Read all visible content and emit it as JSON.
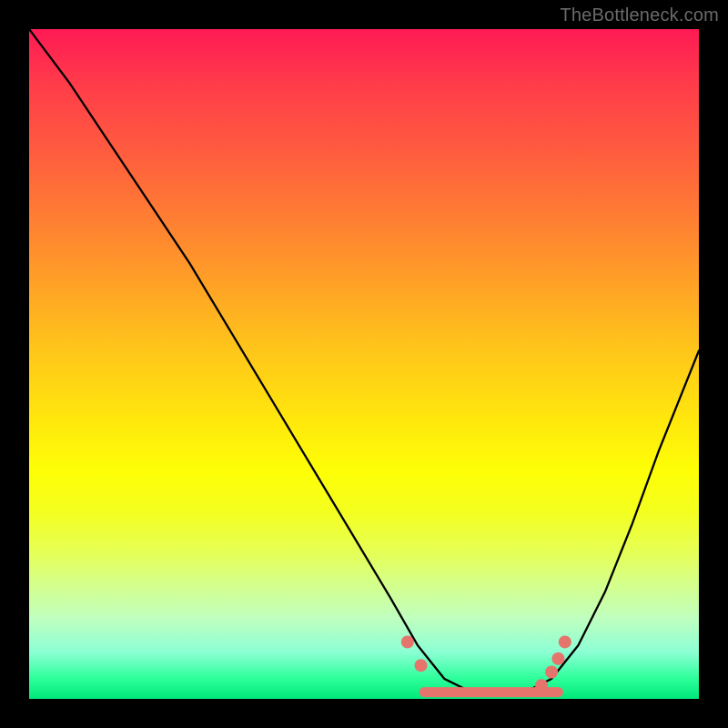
{
  "watermark": "TheBottleneck.com",
  "chart_data": {
    "type": "line",
    "title": "",
    "xlabel": "",
    "ylabel": "",
    "xlim": [
      0,
      100
    ],
    "ylim": [
      0,
      100
    ],
    "series": [
      {
        "name": "bottleneck-curve",
        "x": [
          0,
          6,
          12,
          18,
          24,
          30,
          36,
          42,
          48,
          54,
          58,
          62,
          66,
          70,
          74,
          78,
          82,
          86,
          90,
          94,
          100
        ],
        "y": [
          100,
          92,
          83,
          74,
          65,
          55,
          45,
          35,
          25,
          15,
          8,
          3,
          1,
          1,
          1,
          3,
          8,
          16,
          26,
          37,
          52
        ]
      }
    ],
    "floor_region": {
      "x_start": 59,
      "x_end": 79,
      "y": 1
    },
    "markers": [
      {
        "x": 56.5,
        "y": 8.5
      },
      {
        "x": 58.5,
        "y": 5.0
      },
      {
        "x": 76.5,
        "y": 2.0
      },
      {
        "x": 78.0,
        "y": 4.0
      },
      {
        "x": 79.0,
        "y": 6.0
      },
      {
        "x": 80.0,
        "y": 8.5
      }
    ],
    "colors": {
      "curve": "#000000",
      "marker": "#e5746c",
      "gradient_top": "#ff1a55",
      "gradient_bottom": "#00e87a"
    }
  }
}
